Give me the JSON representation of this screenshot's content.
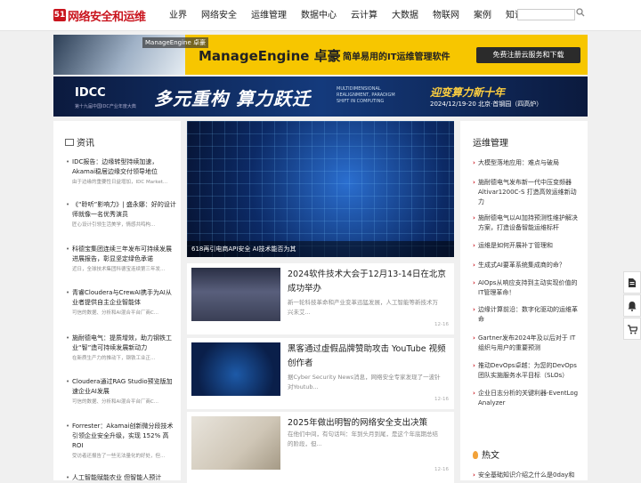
{
  "logo": {
    "mark": "51",
    "text": "网络安全和运维"
  },
  "nav": [
    "业界",
    "网络安全",
    "运维管理",
    "数据中心",
    "云计算",
    "大数据",
    "物联网",
    "案例",
    "知识"
  ],
  "search": {
    "placeholder": "",
    "icon": "search-icon"
  },
  "ad1": {
    "vr_badge": "ManageEngine 卓豪",
    "brand": "ManageEngine 卓豪",
    "slogan": "简单易用的IT运维管理软件",
    "cta": "免费注册云服务和下载"
  },
  "ad2": {
    "logo": "IDCC",
    "logo_sub": "第十九届中国IDC产业年度大典",
    "headline": "多元重构 算力跃迁",
    "sub": "MULTIDIMENSIONAL REALIGNMENT, PARADIGM SHIFT IN COMPUTING",
    "welcome": "迎变算力新十年",
    "date": "2024/12/19-20 北京·首钢园（四高炉）"
  },
  "left": {
    "title": "资讯",
    "items": [
      {
        "title": "IDC报告：边缘转型持续加速，Akamai稳居边缘交付领导地位",
        "summary": "由于边缘的重要性日益增加，IDC Market..."
      },
      {
        "title": "《“聆听”影响力》| 盛永娜：好的设计师就像一名优秀演员",
        "summary": "匠心设计引领生活美学，情感共鸣构..."
      },
      {
        "title": "科德宝集团连续三年发布可持续发展进展报告，彰显坚定绿色承诺",
        "summary": "近日，全球技术集团科德宝连续第三年发..."
      },
      {
        "title": "青睿Cloudera与CrewAI携手为AI从业者提供自主企业智能体",
        "summary": "可信的数据、分析和AI混合平台厂商C..."
      },
      {
        "title": "施耐德电气：提质增效，助力钢铁工业“智”造可持续发展新动力",
        "summary": "在新质生产力的推动下，钢铁工业正..."
      },
      {
        "title": "Cloudera通过RAG Studio预览版加速企业AI发展",
        "summary": "可信的数据、分析和AI混合平台厂商C..."
      },
      {
        "title": "Forrester：Akamai创新微分段技术引领企业安全升级，实现 152% 高ROI",
        "summary": "受访者还报告了一些无法量化的好处，但..."
      },
      {
        "title": "人工智能赋能农业 但智能人预计"
      }
    ]
  },
  "center": {
    "hero_caption": "618再引电商API安全 AI技术能否为其",
    "articles": [
      {
        "title": "2024软件技术大会于12月13-14日在北京成功举办",
        "desc": "新一轮科技革命和产业变革迅猛发展，人工智能等新技术万兴未艾...",
        "date": "12-16"
      },
      {
        "title": "黑客通过虚假品牌赞助攻击 YouTube 视频创作者",
        "desc": "据Cyber Security News消息，网络安全专家发现了一波针对Youtub...",
        "date": "12-16"
      },
      {
        "title": "2025年做出明智的网络安全支出决策",
        "desc": "在他们中间，有句话叫：年到头月到尾，是这个年底期总结的阶段，但...",
        "date": "12-16"
      }
    ]
  },
  "right": {
    "title": "运维管理",
    "items": [
      "大模型落地应用：难点与破局",
      "施耐德电气发布新一代中压变频器Altivar1200C-S 打造高效运维新动力",
      "施耐德电气以AI加持预测性维护解决方案，打造设备智能运维标杆",
      "运维是如何开展补丁管理和",
      "生成式AI要革系统集成商的命？",
      "AIOps从响应支持到主动实现价值的IT管理革命！",
      "边缘计算前沿：数字化驱动的运维革命",
      "Gartner发布2024年及以后对于 IT组织与用户的重要预测",
      "推动DevOps卓越：为您的DevOps团队实施服务水平目标（SLOs）",
      "企业日志分析的关键利器-EventLog Analyzer"
    ],
    "hot_title": "热文",
    "hot_item": "安全基础知识介绍之什么是0day和"
  },
  "floating": [
    "document-icon",
    "bell-icon",
    "cart-icon"
  ]
}
